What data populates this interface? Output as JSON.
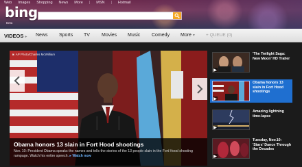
{
  "topnav": {
    "items": [
      "Web",
      "Images",
      "Shopping",
      "News",
      "More",
      "MSN",
      "Hotmail"
    ]
  },
  "brand": {
    "logo": "bing",
    "sub": "Beta"
  },
  "search": {
    "value": "",
    "placeholder": ""
  },
  "categories": {
    "active": "VIDEOS",
    "items": [
      "News",
      "Sports",
      "TV",
      "Movies",
      "Music",
      "Comedy"
    ],
    "more": "More",
    "queue": "QUEUE (0)"
  },
  "hero": {
    "credit": "AP Photo/Charles McWilliam",
    "title": "Obama honors 13 slain in Fort Hood shootings",
    "description": "Nov. 10: President Obama speaks the names and tells the stories of the 13 people slain in the Fort Hood shooting rampage. Watch his entire speech.",
    "watch_label": "Watch now"
  },
  "related": [
    {
      "label": "'The Twilight Saga: New Moon' HD Trailer",
      "active": false
    },
    {
      "label": "Obama honors 13 slain in Fort Hood shootings",
      "active": true
    },
    {
      "label": "Amazing lightning time-lapse",
      "active": false
    },
    {
      "label": "Tuesday, Nov.10: 'Stars' Dance Through the Decades",
      "active": false
    }
  ],
  "colors": {
    "accent_blue": "#1f6fd0",
    "search_orange": "#f5a623",
    "header_purple": "#6b2a4d"
  },
  "icons": {
    "search": "magnifier-icon",
    "prev": "chevron-left-icon",
    "next": "chevron-right-icon",
    "play": "play-icon",
    "queue": "plus-icon",
    "camera": "camera-icon"
  }
}
